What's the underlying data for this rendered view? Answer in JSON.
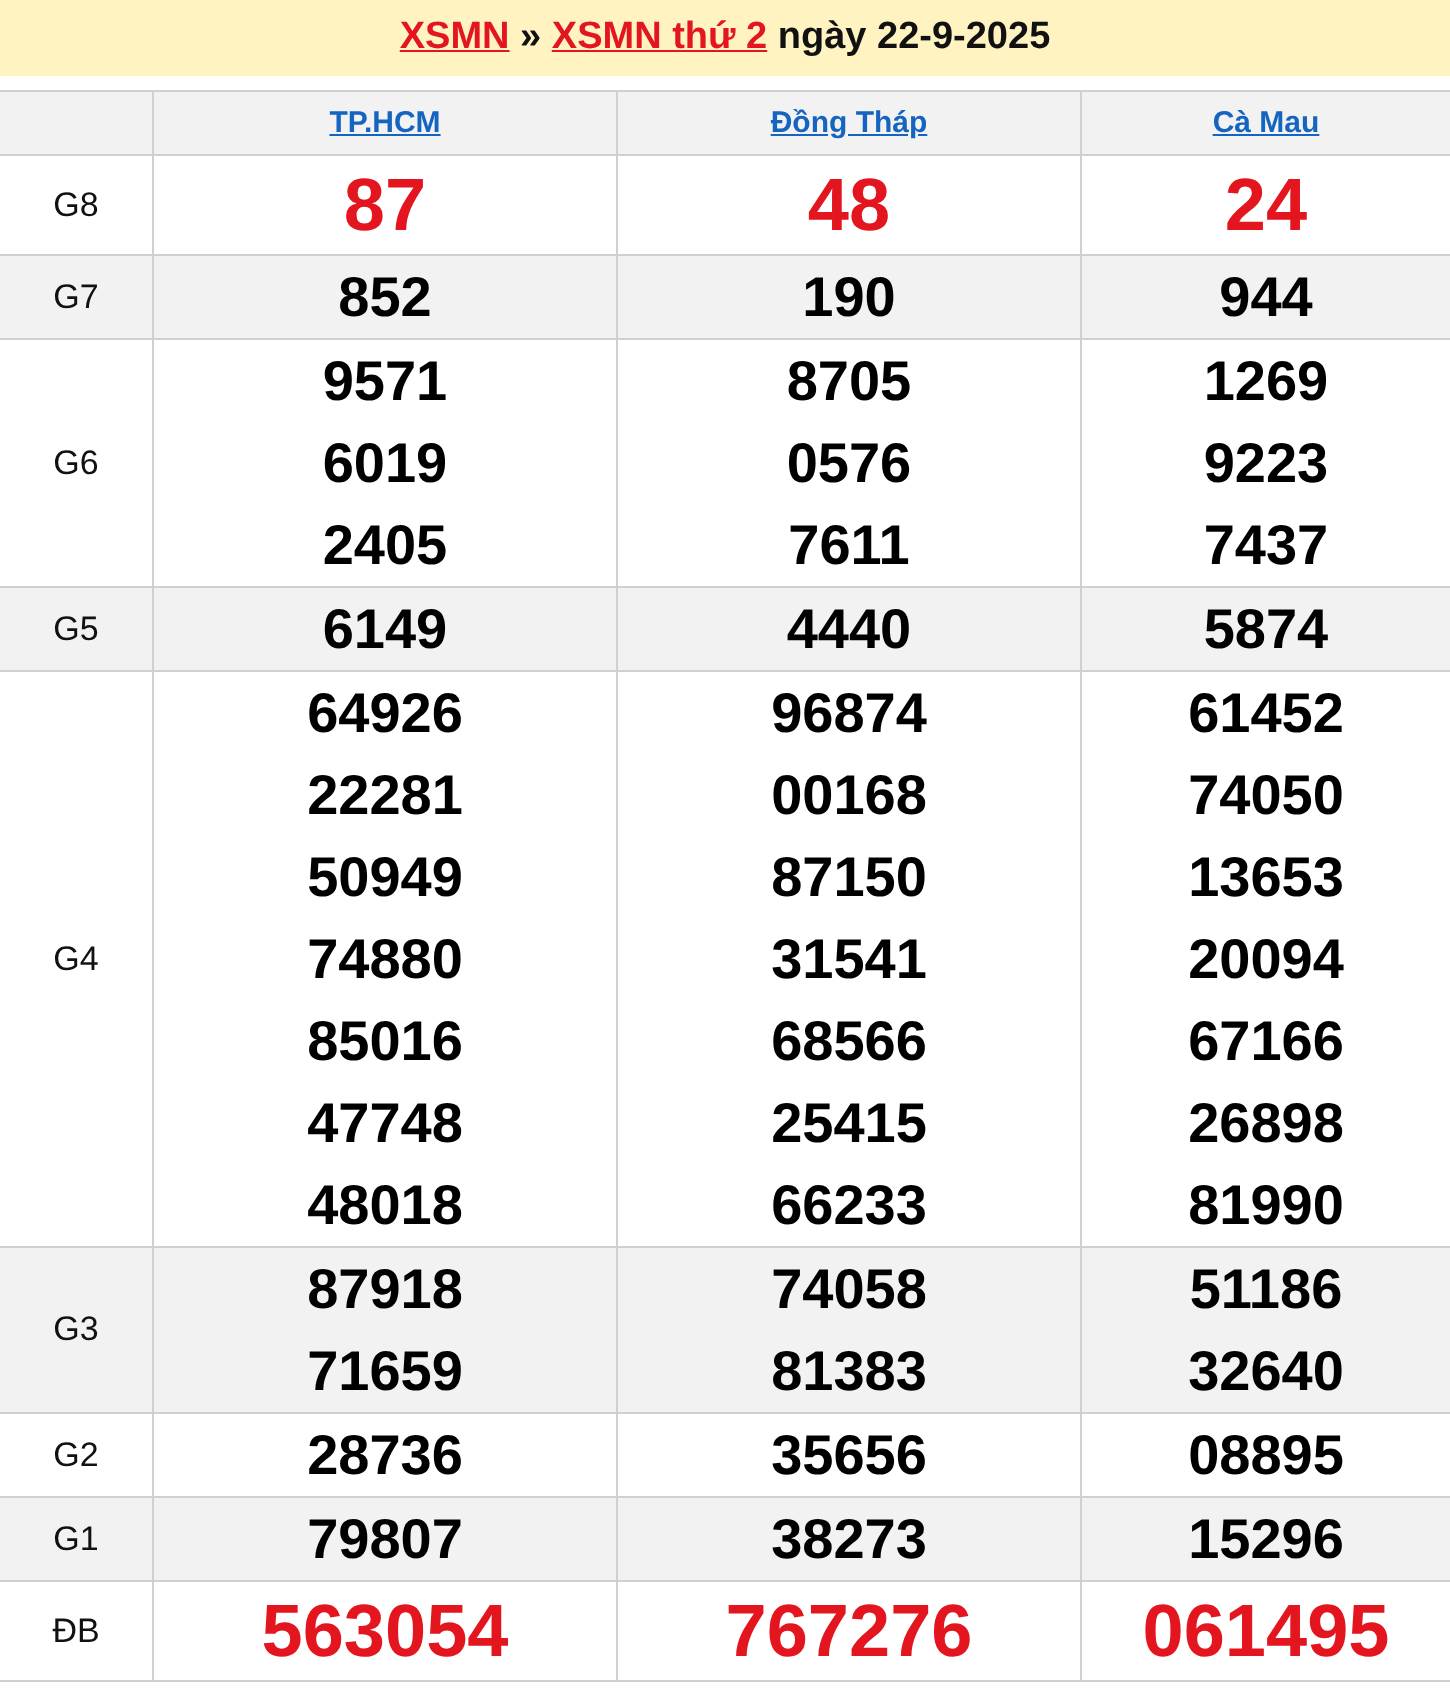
{
  "title": {
    "links": [
      "XSMN",
      "XSMN thứ 2"
    ],
    "separator": "»",
    "date_text": "ngày 22-9-2025"
  },
  "provinces": [
    "TP.HCM",
    "Đồng Tháp",
    "Cà Mau"
  ],
  "prizes": [
    {
      "label": "G8",
      "kind": "highlight",
      "cells": [
        [
          "87"
        ],
        [
          "48"
        ],
        [
          "24"
        ]
      ]
    },
    {
      "label": "G7",
      "kind": "normal",
      "cells": [
        [
          "852"
        ],
        [
          "190"
        ],
        [
          "944"
        ]
      ]
    },
    {
      "label": "G6",
      "kind": "normal",
      "cells": [
        [
          "9571",
          "6019",
          "2405"
        ],
        [
          "8705",
          "0576",
          "7611"
        ],
        [
          "1269",
          "9223",
          "7437"
        ]
      ]
    },
    {
      "label": "G5",
      "kind": "normal",
      "cells": [
        [
          "6149"
        ],
        [
          "4440"
        ],
        [
          "5874"
        ]
      ]
    },
    {
      "label": "G4",
      "kind": "normal",
      "cells": [
        [
          "64926",
          "22281",
          "50949",
          "74880",
          "85016",
          "47748",
          "48018"
        ],
        [
          "96874",
          "00168",
          "87150",
          "31541",
          "68566",
          "25415",
          "66233"
        ],
        [
          "61452",
          "74050",
          "13653",
          "20094",
          "67166",
          "26898",
          "81990"
        ]
      ]
    },
    {
      "label": "G3",
      "kind": "normal",
      "cells": [
        [
          "87918",
          "71659"
        ],
        [
          "74058",
          "81383"
        ],
        [
          "51186",
          "32640"
        ]
      ]
    },
    {
      "label": "G2",
      "kind": "normal",
      "cells": [
        [
          "28736"
        ],
        [
          "35656"
        ],
        [
          "08895"
        ]
      ]
    },
    {
      "label": "G1",
      "kind": "normal",
      "cells": [
        [
          "79807"
        ],
        [
          "38273"
        ],
        [
          "15296"
        ]
      ]
    },
    {
      "label": "ĐB",
      "kind": "highlight",
      "cells": [
        [
          "563054"
        ],
        [
          "767276"
        ],
        [
          "061495"
        ]
      ]
    }
  ]
}
